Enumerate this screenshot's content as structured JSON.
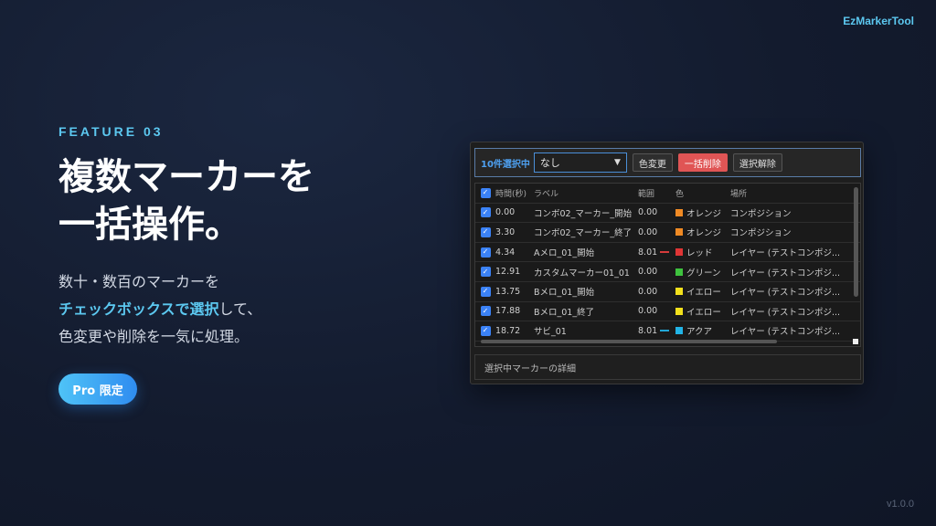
{
  "brand": "EzMarkerTool",
  "version": "v1.0.0",
  "feature_label": "FEATURE 03",
  "headline": [
    "複数マーカーを",
    "一括操作。"
  ],
  "description": {
    "line1": "数十・数百のマーカーを",
    "line2_highlight": "チェックボックスで選択",
    "line2_rest": "して、",
    "line3": "色変更や削除を一気に処理。"
  },
  "pro_badge": "Pro 限定",
  "app": {
    "toolbar": {
      "selected_count": "10件選択中",
      "select_value": "なし",
      "color_change": "色変更",
      "bulk_delete": "一括削除",
      "deselect": "選択解除"
    },
    "columns": [
      "時間(秒)",
      "ラベル",
      "範囲",
      "色",
      "場所"
    ],
    "rows": [
      {
        "time": "0.00",
        "label": "コンボ02_マーカー_開始",
        "range": "0.00",
        "range_bar": "",
        "color_name": "オレンジ",
        "swatch": "#f08a24",
        "place": "コンポジション"
      },
      {
        "time": "3.30",
        "label": "コンボ02_マーカー_終了",
        "range": "0.00",
        "range_bar": "",
        "color_name": "オレンジ",
        "swatch": "#f08a24",
        "place": "コンポジション"
      },
      {
        "time": "4.34",
        "label": "Aメロ_01_開始",
        "range": "8.01",
        "range_bar": "#d63b3b",
        "color_name": "レッド",
        "swatch": "#e03535",
        "place": "レイヤー (テストコンポジ..."
      },
      {
        "time": "12.91",
        "label": "カスタムマーカー01_01",
        "range": "0.00",
        "range_bar": "",
        "color_name": "グリーン",
        "swatch": "#3ec23e",
        "place": "レイヤー (テストコンポジ..."
      },
      {
        "time": "13.75",
        "label": "Bメロ_01_開始",
        "range": "0.00",
        "range_bar": "",
        "color_name": "イエロー",
        "swatch": "#f2e01c",
        "place": "レイヤー (テストコンポジ..."
      },
      {
        "time": "17.88",
        "label": "Bメロ_01_終了",
        "range": "0.00",
        "range_bar": "",
        "color_name": "イエロー",
        "swatch": "#f2e01c",
        "place": "レイヤー (テストコンポジ..."
      },
      {
        "time": "18.72",
        "label": "サビ_01",
        "range": "8.01",
        "range_bar": "#22a6d6",
        "color_name": "アクア",
        "swatch": "#22b4e6",
        "place": "レイヤー (テストコンポジ..."
      }
    ],
    "details_title": "選択中マーカーの詳細"
  },
  "colors": {
    "accent": "#5cc8f0",
    "primary_blue": "#2f8cf0",
    "danger": "#e05555"
  }
}
